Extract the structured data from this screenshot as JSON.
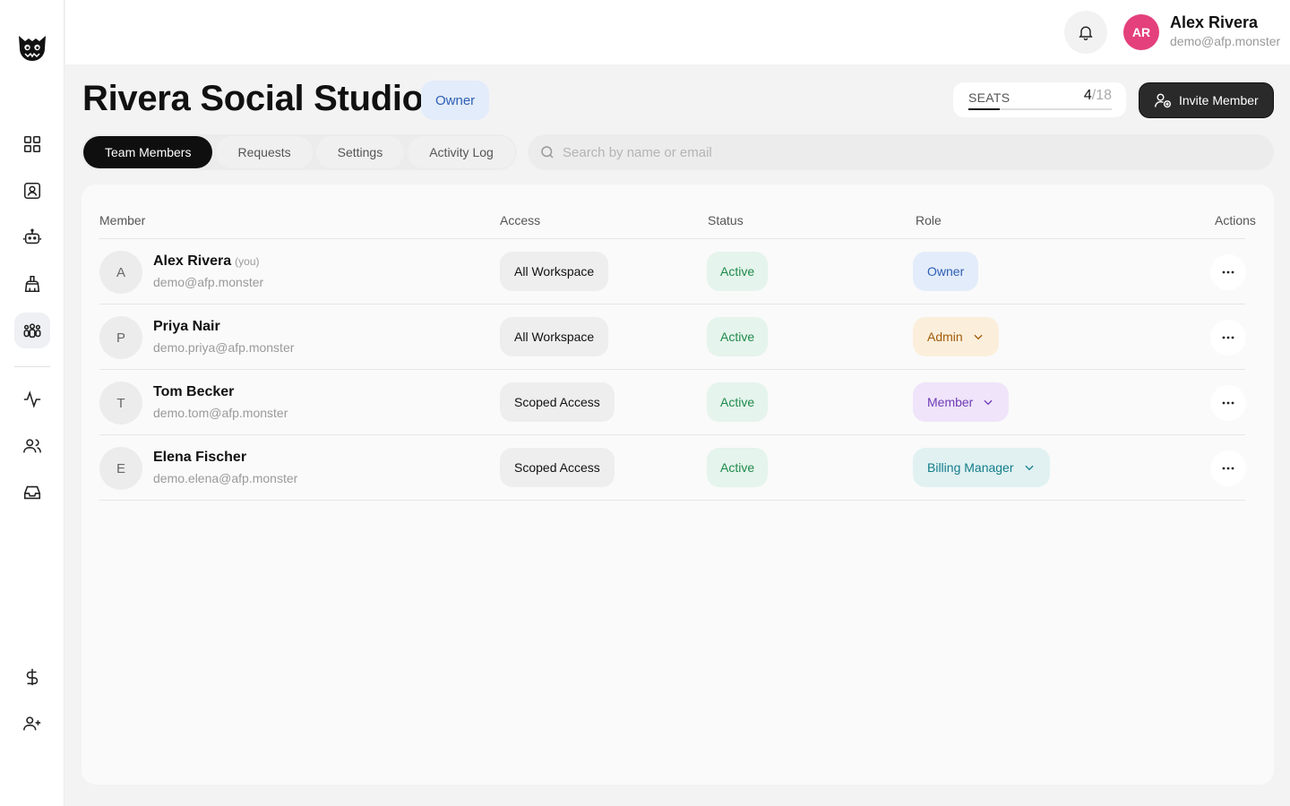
{
  "sidebar": {
    "logo": "monster-logo",
    "nav_icons": [
      "dashboard-icon",
      "contact-card-icon",
      "bot-icon",
      "brush-icon",
      "team-icon",
      "activity-icon",
      "users-icon",
      "inbox-icon",
      "dollar-icon",
      "add-user-icon"
    ],
    "active_item": "team-icon"
  },
  "topbar": {
    "avatar_initials": "AR",
    "user_name": "Alex Rivera",
    "user_email": "demo@afp.monster"
  },
  "header": {
    "title": "Rivera Social Studio",
    "role_badge": "Owner",
    "seats_label": "SEATS",
    "seats_used": "4",
    "seats_total": "/18",
    "seats_fraction": 0.22,
    "invite_label": "Invite Member"
  },
  "tabs": [
    {
      "label": "Team Members",
      "active": true
    },
    {
      "label": "Requests",
      "active": false
    },
    {
      "label": "Settings",
      "active": false
    },
    {
      "label": "Activity Log",
      "active": false
    }
  ],
  "search": {
    "placeholder": "Search by name or email",
    "value": ""
  },
  "table": {
    "columns": [
      "Member",
      "Access",
      "Status",
      "Role",
      "Actions"
    ],
    "rows": [
      {
        "initial": "A",
        "name": "Alex Rivera",
        "you": "(you)",
        "email": "demo@afp.monster",
        "access": "All Workspace",
        "status": "Active",
        "role": "Owner"
      },
      {
        "initial": "P",
        "name": "Priya Nair",
        "you": "",
        "email": "demo.priya@afp.monster",
        "access": "All Workspace",
        "status": "Active",
        "role": "Admin"
      },
      {
        "initial": "T",
        "name": "Tom Becker",
        "you": "",
        "email": "demo.tom@afp.monster",
        "access": "Scoped Access",
        "status": "Active",
        "role": "Member"
      },
      {
        "initial": "E",
        "name": "Elena Fischer",
        "you": "",
        "email": "demo.elena@afp.monster",
        "access": "Scoped Access",
        "status": "Active",
        "role": "Billing Manager"
      }
    ]
  },
  "colors": {
    "accent_dark": "#0f0f0f",
    "avatar_pink": "#e4407c",
    "status_green": "#1f8a4c",
    "owner_blue": "#2d5fb3",
    "admin_orange": "#a35a06",
    "member_purple": "#6d3bb5",
    "billing_teal": "#137d8a"
  }
}
